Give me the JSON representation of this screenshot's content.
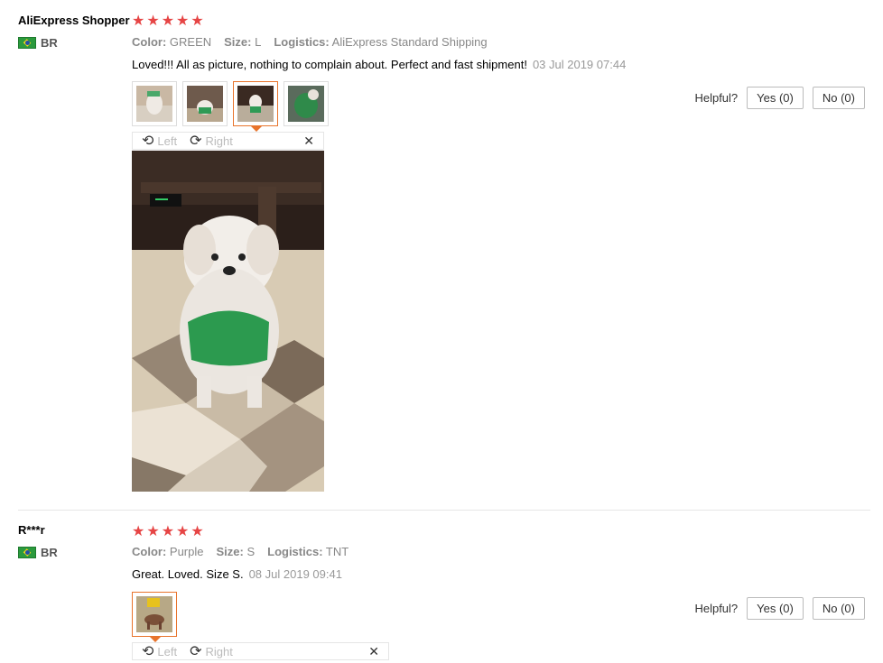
{
  "reviews": [
    {
      "user": "AliExpress Shopper",
      "country": "BR",
      "stars": 5,
      "color_label": "Color:",
      "color_value": "GREEN",
      "size_label": "Size:",
      "size_value": "L",
      "logistics_label": "Logistics:",
      "logistics_value": "AliExpress Standard Shipping",
      "text": "Loved!!! All as picture, nothing to complain about. Perfect and fast shipment!",
      "date": "03 Jul 2019 07:44",
      "helpful_label": "Helpful?",
      "yes_label": "Yes (0)",
      "no_label": "No (0)",
      "rotate_left": "Left",
      "rotate_right": "Right"
    },
    {
      "user": "R***r",
      "country": "BR",
      "stars": 5,
      "color_label": "Color:",
      "color_value": "Purple",
      "size_label": "Size:",
      "size_value": "S",
      "logistics_label": "Logistics:",
      "logistics_value": "TNT",
      "text": "Great. Loved. Size S.",
      "date": "08 Jul 2019 09:41",
      "helpful_label": "Helpful?",
      "yes_label": "Yes (0)",
      "no_label": "No (0)",
      "rotate_left": "Left",
      "rotate_right": "Right"
    }
  ],
  "icons": {
    "star": "★",
    "rotate_left": "⟲",
    "rotate_right": "⟳",
    "close": "✕"
  },
  "colors": {
    "star": "#e64545",
    "active_thumb": "#e8742c"
  }
}
